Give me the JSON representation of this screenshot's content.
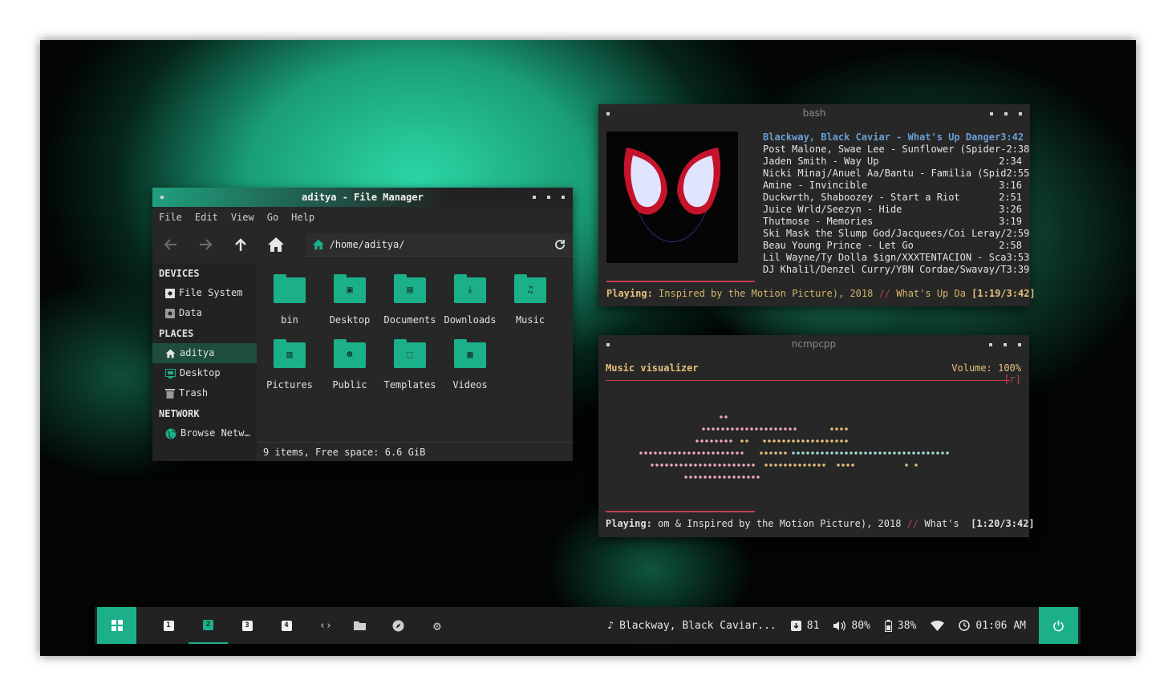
{
  "file_manager": {
    "title": "aditya - File Manager",
    "menu": [
      "File",
      "Edit",
      "View",
      "Go",
      "Help"
    ],
    "path": "/home/aditya/",
    "sidebar": {
      "devices_header": "DEVICES",
      "devices": [
        "File System",
        "Data"
      ],
      "places_header": "PLACES",
      "places": [
        "aditya",
        "Desktop",
        "Trash"
      ],
      "network_header": "NETWORK",
      "network": [
        "Browse Netw…"
      ]
    },
    "folders": [
      {
        "name": "bin",
        "icon": "folder-icon"
      },
      {
        "name": "Desktop",
        "icon": "desktop-folder-icon"
      },
      {
        "name": "Documents",
        "icon": "documents-folder-icon"
      },
      {
        "name": "Downloads",
        "icon": "downloads-folder-icon"
      },
      {
        "name": "Music",
        "icon": "music-folder-icon"
      },
      {
        "name": "Pictures",
        "icon": "pictures-folder-icon"
      },
      {
        "name": "Public",
        "icon": "public-folder-icon"
      },
      {
        "name": "Templates",
        "icon": "templates-folder-icon"
      },
      {
        "name": "Videos",
        "icon": "videos-folder-icon"
      }
    ],
    "status": "9 items, Free space: 6.6 GiB"
  },
  "bash": {
    "title": "bash",
    "tracks": [
      {
        "title": "Blackway, Black Caviar - What's Up Danger",
        "time": "3:42",
        "current": true
      },
      {
        "title": "Post Malone, Swae Lee - Sunflower (Spider-",
        "time": "2:38"
      },
      {
        "title": "Jaden Smith - Way Up",
        "time": "2:34"
      },
      {
        "title": "Nicki Minaj/Anuel Aa/Bantu - Familia (Spid",
        "time": "2:55"
      },
      {
        "title": "Amine - Invincible",
        "time": "3:16"
      },
      {
        "title": "Duckwrth, Shaboozey - Start a Riot",
        "time": "2:51"
      },
      {
        "title": "Juice Wrld/Seezyn - Hide",
        "time": "3:26"
      },
      {
        "title": "Thutmose - Memories",
        "time": "3:19"
      },
      {
        "title": "Ski Mask the Slump God/Jacquees/Coi Leray/",
        "time": "2:59"
      },
      {
        "title": "Beau Young Prince - Let Go",
        "time": "2:58"
      },
      {
        "title": "Lil Wayne/Ty Dolla $ign/XXXTENTACION - Sca",
        "time": "3:53"
      },
      {
        "title": "DJ Khalil/Denzel Curry/YBN Cordae/Swavay/T",
        "time": "3:39"
      }
    ],
    "playing_label": "Playing:",
    "playing_text": " Inspired by the Motion Picture), 2018 ",
    "playing_sep": "//",
    "playing_tail": " What's Up Da ",
    "playing_time": "[1:19/3:42]",
    "progress": 0.357
  },
  "ncmpcpp": {
    "title": "ncmpcpp",
    "visualizer_label": "Music visualizer",
    "volume": "Volume: 100%",
    "flag": "[r]",
    "playing_label": "Playing:",
    "playing_text": " om & Inspired by the Motion Picture), 2018 ",
    "playing_sep": "//",
    "playing_tail": " What's  ",
    "playing_time": "[1:20/3:42]",
    "progress": 0.36
  },
  "taskbar": {
    "workspaces": [
      "1",
      "2",
      "3",
      "4"
    ],
    "active_workspace": "2",
    "now_playing": "Blackway, Black Caviar...",
    "updates": "81",
    "volume": "80%",
    "battery": "38%",
    "clock": "01:06 AM"
  },
  "colors": {
    "accent": "#1bb08a",
    "red": "#c2404a",
    "yellow": "#e5c07b",
    "blue": "#6a9fd2"
  }
}
